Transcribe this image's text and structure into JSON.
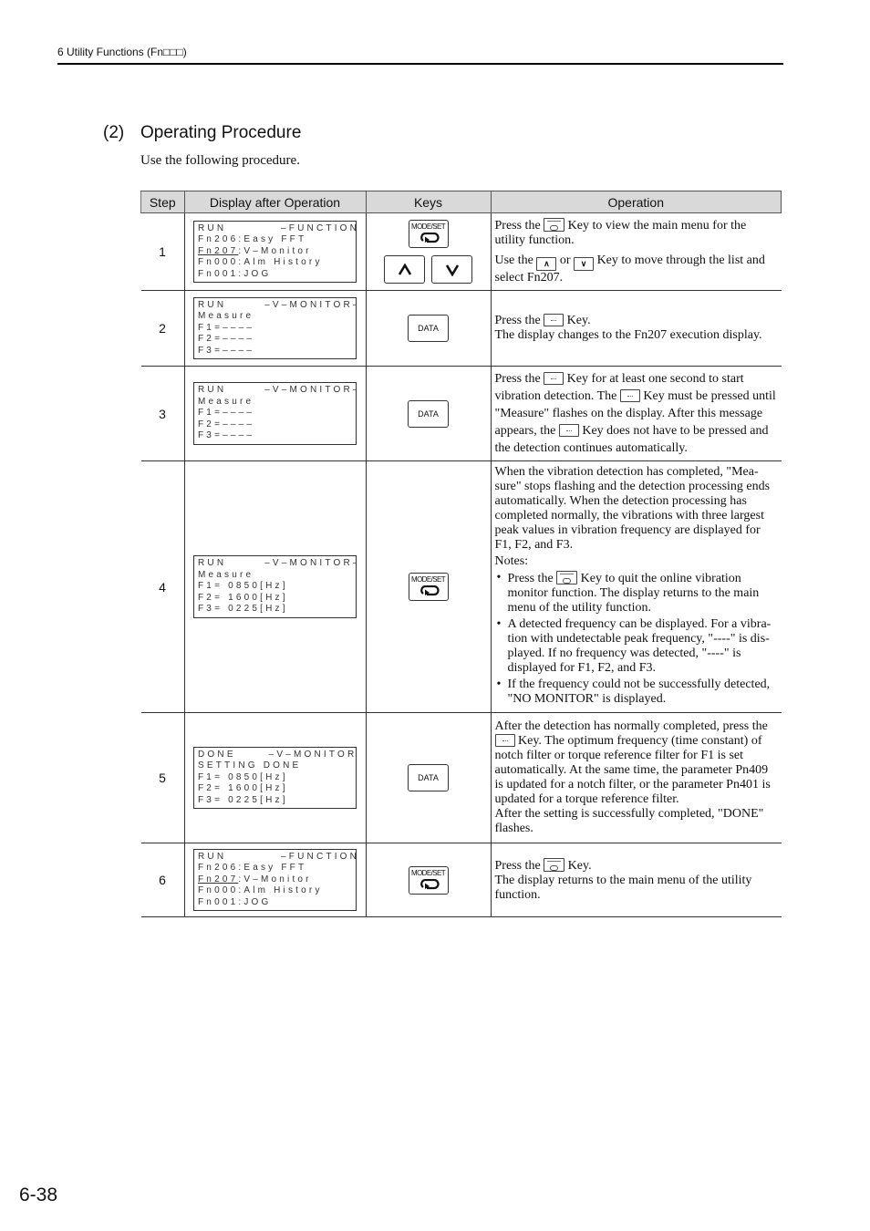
{
  "header": {
    "section_label": "6  Utility Functions (Fn□□□)"
  },
  "section": {
    "number": "(2)",
    "title": "Operating Procedure",
    "intro": "Use the following procedure."
  },
  "table": {
    "columns": [
      "Step",
      "Display after Operation",
      "Keys",
      "Operation"
    ],
    "rows": [
      {
        "step": "1",
        "display": [
          "RUN          –FUNCTION–",
          "Fn206:Easy FFT",
          "Fn207",
          ":V–Monitor",
          "Fn000:Alm History",
          "Fn001:JOG"
        ],
        "keys": [
          "MODE/SET",
          "up-arrow",
          "down-arrow"
        ],
        "operation": {
          "p1_a": "Press the",
          "p1_b": "Key to view the main menu for the utility function.",
          "p2_a": "Use the",
          "p2_or": "or",
          "p2_b": "Key to move through the list and select Fn207."
        }
      },
      {
        "step": "2",
        "display": [
          "RUN       –V–MONITOR–",
          "Measure",
          "F1=––––",
          "F2=––––",
          "F3=––––"
        ],
        "keys": [
          "DATA"
        ],
        "operation": {
          "p1_a": "Press the",
          "p1_b": "Key.",
          "p2": "The display changes to the Fn207 execution display."
        }
      },
      {
        "step": "3",
        "display": [
          "RUN       –V–MONITOR–",
          "Measure",
          "F1=––––",
          "F2=––––",
          "F3=––––"
        ],
        "keys": [
          "DATA"
        ],
        "operation": {
          "p1_a": "Press the",
          "p1_b": "Key for at least one second to start vibration detection. The",
          "p1_c": "Key must be pressed until \"Measure\" flashes on the display. After this message appears, the",
          "p1_d": "Key does not have to be pressed and the detection continues automatically."
        }
      },
      {
        "step": "4",
        "display": [
          "RUN       –V–MONITOR–",
          "Measure",
          "F1= 0850[Hz]",
          "F2= 1600[Hz]",
          "F3= 0225[Hz]"
        ],
        "keys": [
          "MODE/SET"
        ],
        "operation": {
          "p1": "When the vibration detection has completed, \"Mea-sure\" stops flashing and the detection processing ends automatically. When the detection processing has completed normally, the vibrations with three largest peak values in vibration frequency are displayed for F1, F2, and F3.",
          "notes_label": "Notes:",
          "note1_a": "Press the",
          "note1_b": "Key to quit the online vibration monitor function. The display returns to the main menu of the utility function.",
          "note2": "A detected frequency can be displayed. For a vibra-tion with undetectable peak frequency, \"----\" is dis-played. If no frequency was detected, \"----\" is displayed for F1, F2, and F3.",
          "note3": "If the frequency could not be successfully detected, \"NO MONITOR\" is displayed."
        }
      },
      {
        "step": "5",
        "display": [
          "DONE      –V–MONITOR–",
          "SETTING DONE",
          "F1= 0850[Hz]",
          "F2= 1600[Hz]",
          "F3= 0225[Hz]"
        ],
        "keys": [
          "DATA"
        ],
        "operation": {
          "p1_a": "After the detection has normally completed, press the",
          "p1_b": "Key. The optimum frequency (time constant) of notch filter or torque reference filter for F1 is set automatically. At the same time, the parameter Pn409 is updated for a notch filter, or the parameter Pn401 is updated for a torque reference filter.",
          "p2": "After the setting is successfully completed, \"DONE\" flashes."
        }
      },
      {
        "step": "6",
        "display": [
          "RUN          –FUNCTION–",
          "Fn206:Easy FFT",
          "Fn207",
          ":V–Monitor",
          "Fn000:Alm History",
          "Fn001:JOG"
        ],
        "keys": [
          "MODE/SET"
        ],
        "operation": {
          "p1_a": "Press the",
          "p1_b": "Key.",
          "p2": "The display returns to the main menu of the utility function."
        }
      }
    ]
  },
  "footer": {
    "page_number": "6-38"
  }
}
